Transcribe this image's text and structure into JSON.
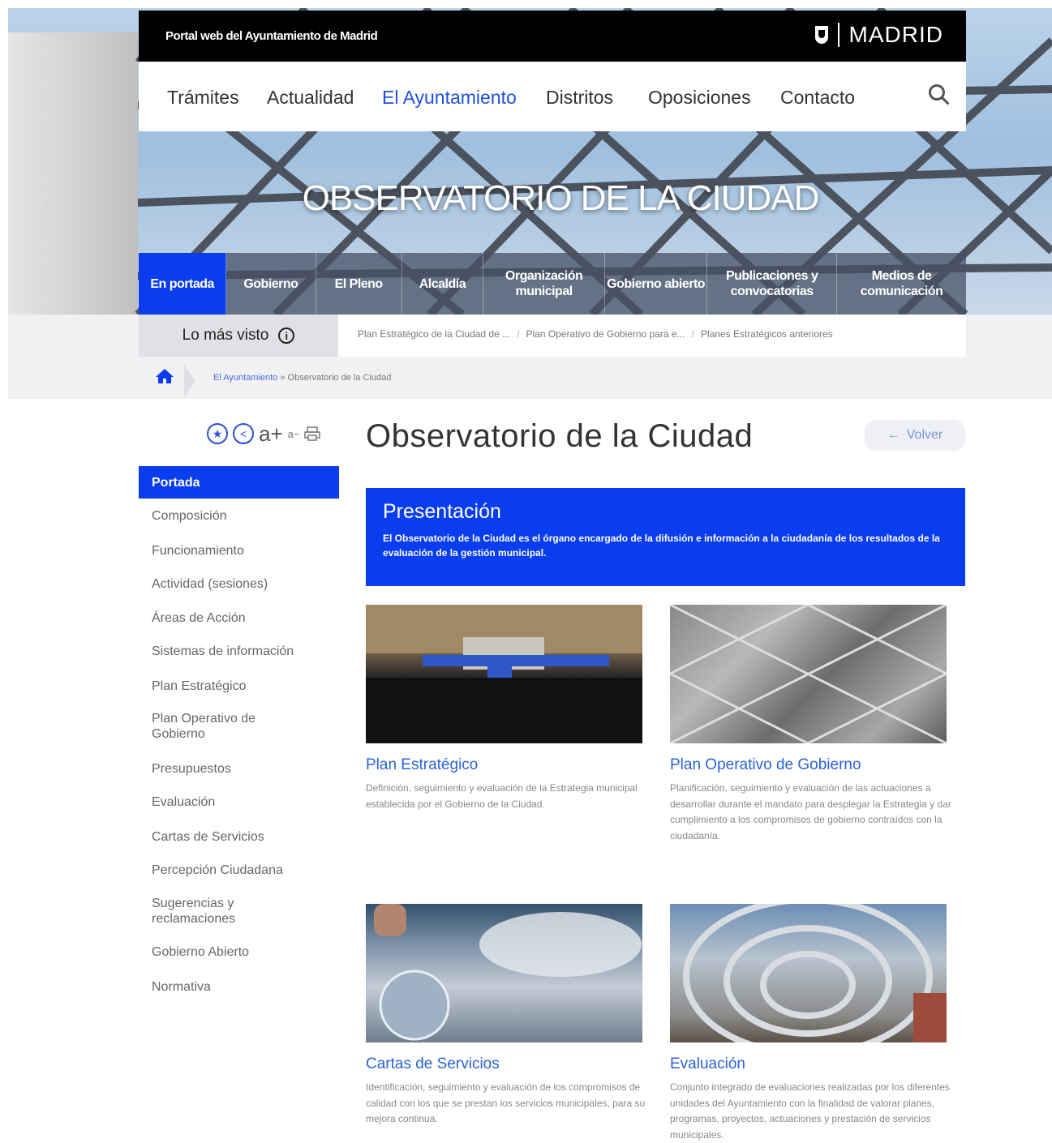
{
  "header": {
    "portal_label": "Portal web del Ayuntamiento de Madrid",
    "brand": "MADRID",
    "nav": [
      "Trámites",
      "Actualidad",
      "El Ayuntamiento",
      "Distritos",
      "Oposiciones",
      "Contacto"
    ],
    "nav_active": "El Ayuntamiento",
    "hero_title": "OBSERVATORIO DE LA CIUDAD"
  },
  "subnav": [
    {
      "label": "En portada",
      "active": true
    },
    {
      "label": "Gobierno",
      "active": false
    },
    {
      "label": "El Pleno",
      "active": false
    },
    {
      "label": "Alcaldía",
      "active": false
    },
    {
      "label": "Organización municipal",
      "active": false
    },
    {
      "label": "Gobierno abierto",
      "active": false
    },
    {
      "label": "Publicaciones y convocatorias",
      "active": false
    },
    {
      "label": "Medios de comunicación",
      "active": false
    }
  ],
  "mas_visto": {
    "label": "Lo más visto",
    "info_glyph": "i",
    "links": [
      "Plan Estratégico de la Ciudad de ...",
      "Plan Operativo de Gobierno para e...",
      "Planes Estratégicos anteriores"
    ]
  },
  "breadcrumb": {
    "items": [
      "El Ayuntamiento",
      "Observatorio de la Ciudad"
    ],
    "separator": "»"
  },
  "tools": {
    "text_size": "a+",
    "small": "a−"
  },
  "page": {
    "title": "Observatorio de la Ciudad",
    "back": "Volver"
  },
  "sidebar": [
    {
      "label": "Portada",
      "active": true
    },
    {
      "label": "Composición"
    },
    {
      "label": "Funcionamiento"
    },
    {
      "label": "Actividad (sesiones)"
    },
    {
      "label": "Áreas de Acción"
    },
    {
      "label": "Sistemas de información"
    },
    {
      "label": "Plan Estratégico"
    },
    {
      "label": "Plan Operativo de Gobierno"
    },
    {
      "label": "Presupuestos"
    },
    {
      "label": "Evaluación"
    },
    {
      "label": "Cartas de Servicios"
    },
    {
      "label": "Percepción Ciudadana"
    },
    {
      "label": "Sugerencias y reclamaciones"
    },
    {
      "label": "Gobierno Abierto"
    },
    {
      "label": "Normativa"
    }
  ],
  "presentation": {
    "heading": "Presentación",
    "text": "El Observatorio de la Ciudad es el órgano encargado de la difusión e información a la ciudadanía de los resultados de la evaluación de la gestión municipal."
  },
  "cards": [
    {
      "title": "Plan Estratégico",
      "desc": "Definición, seguimiento y evaluación de la Estrategia municipal establecida por el Gobierno de la Ciudad."
    },
    {
      "title": "Plan Operativo de Gobierno",
      "desc": "Planificación, seguimiento y evaluación de las actuaciones a desarrollar durante el mandato para desplegar la Estrategia y dar cumplimiento a los compromisos de gobierno contraídos con la ciudadanía."
    },
    {
      "title": "Cartas de Servicios",
      "desc": "Identificación, seguimiento y evaluación de los compromisos de calidad con los que se prestan los servicios municipales, para su mejora continua."
    },
    {
      "title": "Evaluación",
      "desc": "Conjunto integrado de evaluaciones realizadas por los diferentes unidades del Ayuntamiento con la finalidad de valorar planes, programas, proyectos, actuaciones y prestación de servicios municipales."
    }
  ]
}
